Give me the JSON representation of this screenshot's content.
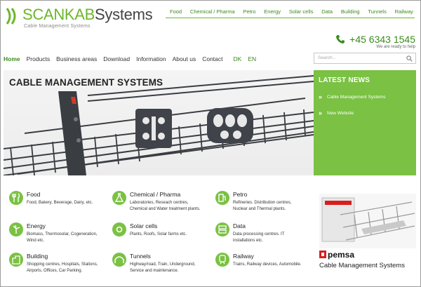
{
  "header": {
    "logo_brand": "SCANKAB",
    "logo_suffix": "Systems",
    "tagline": "Cable Management Systems",
    "phone": "+45 6343 1545",
    "phone_sub": "We are ready to help"
  },
  "topnav": [
    "Food",
    "Chemical / Pharma",
    "Petro",
    "Energy",
    "Solar cells",
    "Data",
    "Building",
    "Tunnels",
    "Railway"
  ],
  "mainnav": {
    "items": [
      "Home",
      "Products",
      "Business areas",
      "Download",
      "Information",
      "About us",
      "Contact"
    ],
    "lang": [
      "DK",
      "EN"
    ]
  },
  "search": {
    "placeholder": "Search..."
  },
  "hero": {
    "title": "CABLE MANAGEMENT SYSTEMS"
  },
  "news": {
    "title": "LATEST NEWS",
    "items": [
      "Cable Management Systems",
      "New Website"
    ]
  },
  "categories": [
    {
      "title": "Food",
      "desc1": "Food, Bakery, Beverage, Dairy, etc.",
      "desc2": "",
      "icon": "food-icon"
    },
    {
      "title": "Chemical / Pharma",
      "desc1": "Laboratories, Reseach centres,",
      "desc2": "Chemical and Water treatment plants.",
      "icon": "flask-icon"
    },
    {
      "title": "Petro",
      "desc1": "Refineries. Distribution centres,",
      "desc2": "Nuclear and Thermal plants.",
      "icon": "fuel-pump-icon"
    },
    {
      "title": "Energy",
      "desc1": "Biomass, Thermosolar, Cogeneration,",
      "desc2": "Wind etc.",
      "icon": "wind-turbine-icon"
    },
    {
      "title": "Solar cells",
      "desc1": "Plants, Roofs, Solar farms etc.",
      "desc2": "",
      "icon": "sun-icon"
    },
    {
      "title": "Data",
      "desc1": "Data processing centres. IT",
      "desc2": "installations etc.",
      "icon": "server-icon"
    },
    {
      "title": "Building",
      "desc1": "Shopping centres, Hospitals, Stations,",
      "desc2": "Airports, Offices, Car Parking.",
      "icon": "building-icon"
    },
    {
      "title": "Tunnels",
      "desc1": "Highway/road, Train, Underground,",
      "desc2": "Service and maintenance.",
      "icon": "tunnel-icon"
    },
    {
      "title": "Railway",
      "desc1": "Trains, Railway devices, Automobile.",
      "desc2": "",
      "icon": "train-icon"
    }
  ],
  "ad": {
    "brand": "pemsa",
    "subtitle": "Cable Management Systems"
  },
  "colors": {
    "accent": "#7bc143",
    "accent_dark": "#3c8a1e",
    "tray": "#3a3d42"
  }
}
